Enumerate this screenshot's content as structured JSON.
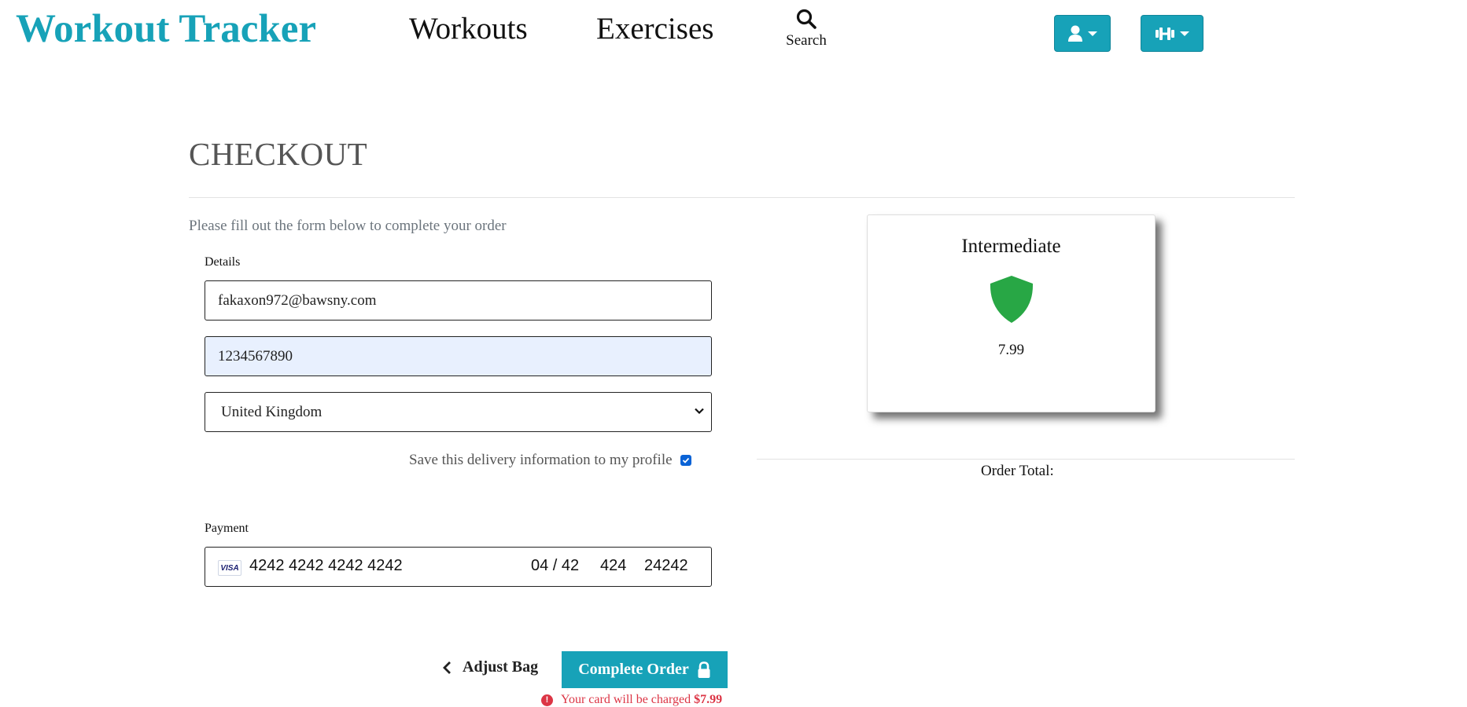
{
  "header": {
    "brand": "Workout Tracker",
    "nav": {
      "workouts": "Workouts",
      "exercises": "Exercises",
      "search": "Search"
    },
    "account_menu_icon": "user-icon",
    "workout_menu_icon": "dumbbell-icon",
    "accent_color": "#17a2b8"
  },
  "checkout": {
    "title": "CHECKOUT",
    "subtitle": "Please fill out the form below to complete your order",
    "details_label": "Details",
    "email_value": "fakaxon972@bawsny.com",
    "phone_value": "1234567890",
    "country_value": "United Kingdom",
    "save_info_label": "Save this delivery information to my profile",
    "save_info_checked": true,
    "payment_label": "Payment",
    "card": {
      "brand": "VISA",
      "number": "4242 4242 4242 4242",
      "expiry": "04 / 42",
      "cvc": "424",
      "postal": "24242"
    }
  },
  "summary": {
    "plan_name": "Intermediate",
    "plan_icon": "shield-icon",
    "plan_icon_color": "#28a745",
    "plan_price": "7.99",
    "order_total_label": "Order Total:"
  },
  "actions": {
    "adjust_bag_label": "Adjust Bag",
    "complete_order_label": "Complete Order",
    "charge_text": "Your card will be charged",
    "charge_amount": "$7.99",
    "error_color": "#dc3545"
  }
}
